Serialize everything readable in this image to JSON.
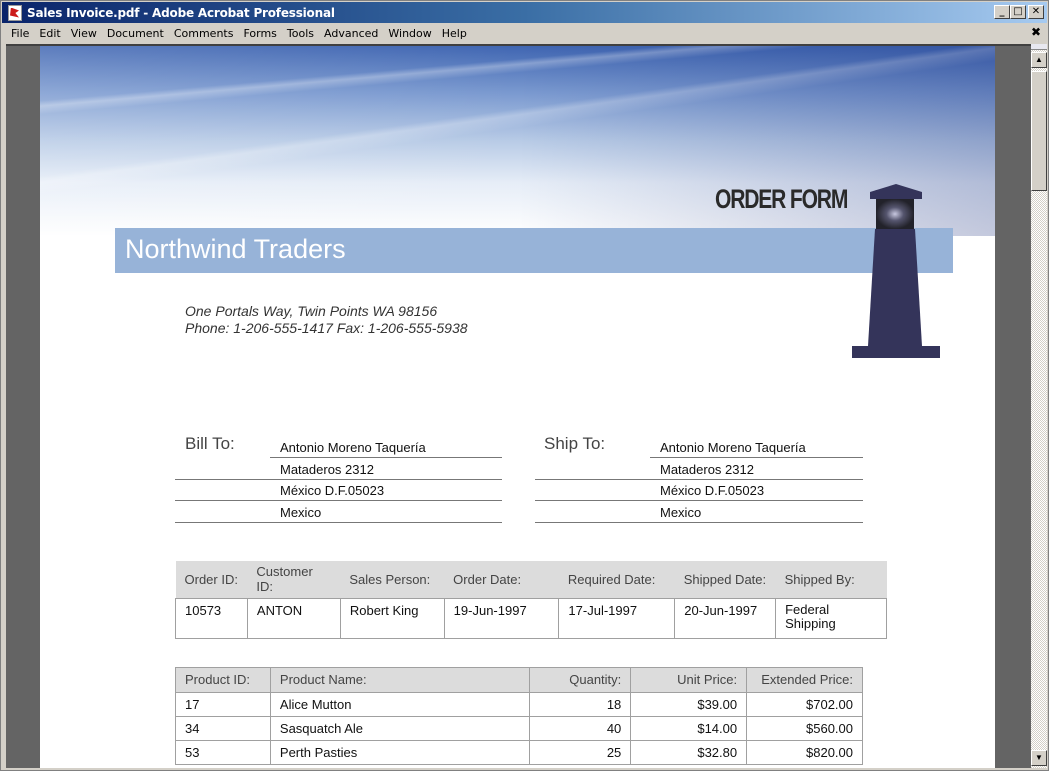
{
  "window": {
    "title": "Sales Invoice.pdf - Adobe Acrobat Professional",
    "controls": {
      "minimize": "_",
      "maximize": "□",
      "close": "✕"
    }
  },
  "menubar": {
    "items": [
      "File",
      "Edit",
      "View",
      "Document",
      "Comments",
      "Forms",
      "Tools",
      "Advanced",
      "Window",
      "Help"
    ],
    "close_doc": "✖"
  },
  "document": {
    "heading": "ORDER FORM",
    "company": "Northwind Traders",
    "address_line1": "One Portals Way, Twin Points WA 98156",
    "address_line2": "Phone: 1-206-555-1417 Fax: 1-206-555-5938",
    "bill_to": {
      "label": "Bill To:",
      "lines": [
        "Antonio Moreno Taquería",
        "Mataderos  2312",
        "México D.F.05023",
        "Mexico"
      ]
    },
    "ship_to": {
      "label": "Ship To:",
      "lines": [
        "Antonio Moreno Taquería",
        "Mataderos  2312",
        "México D.F.05023",
        "Mexico"
      ]
    },
    "order_table": {
      "headers": [
        "Order ID:",
        "Customer ID:",
        "Sales Person:",
        "Order Date:",
        "Required Date:",
        "Shipped Date:",
        "Shipped By:"
      ],
      "row": [
        "10573",
        "ANTON",
        "Robert King",
        "19-Jun-1997",
        "17-Jul-1997",
        "20-Jun-1997",
        "Federal Shipping"
      ]
    },
    "product_table": {
      "headers": [
        "Product ID:",
        "Product Name:",
        "Quantity:",
        "Unit Price:",
        "Extended Price:"
      ],
      "rows": [
        [
          "17",
          "Alice Mutton",
          "18",
          "$39.00",
          "$702.00"
        ],
        [
          "34",
          "Sasquatch Ale",
          "40",
          "$14.00",
          "$560.00"
        ],
        [
          "53",
          "Perth Pasties",
          "25",
          "$32.80",
          "$820.00"
        ]
      ]
    }
  },
  "scrollbar": {
    "up": "▲",
    "down": "▼"
  }
}
